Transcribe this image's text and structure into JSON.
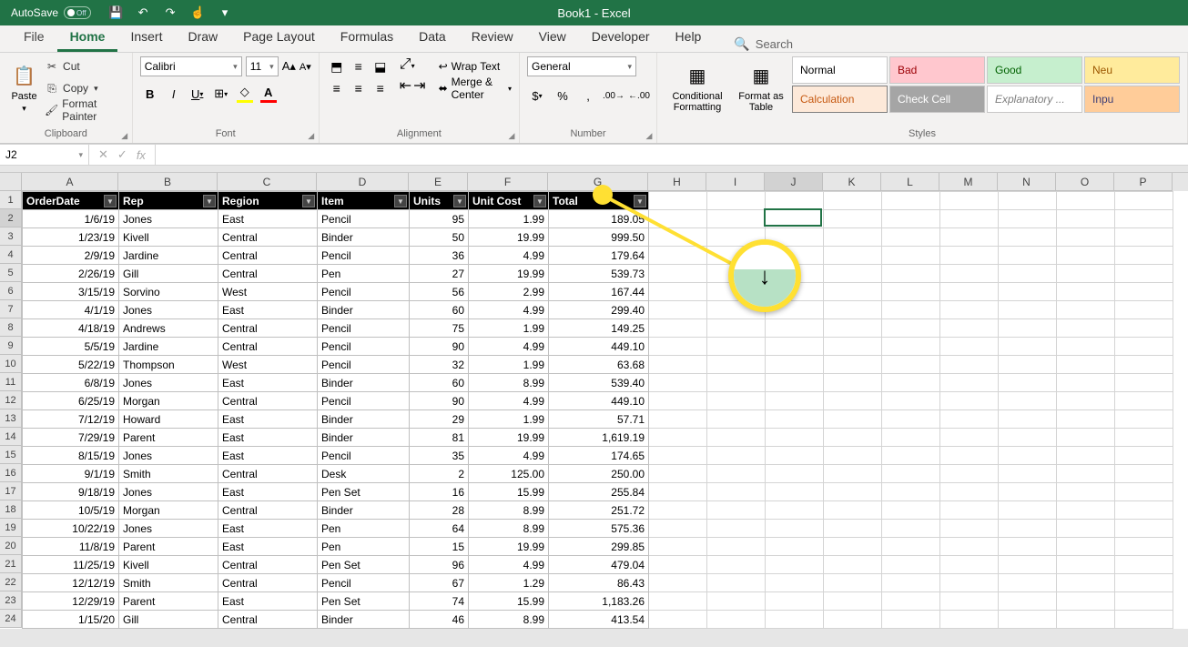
{
  "title": "Book1 - Excel",
  "autosave_label": "AutoSave",
  "autosave_state": "Off",
  "tabs": [
    "File",
    "Home",
    "Insert",
    "Draw",
    "Page Layout",
    "Formulas",
    "Data",
    "Review",
    "View",
    "Developer",
    "Help"
  ],
  "active_tab": "Home",
  "search_placeholder": "Search",
  "ribbon": {
    "clipboard": {
      "label": "Clipboard",
      "paste": "Paste",
      "cut": "Cut",
      "copy": "Copy",
      "painter": "Format Painter"
    },
    "font": {
      "label": "Font",
      "name": "Calibri",
      "size": "11"
    },
    "alignment": {
      "label": "Alignment",
      "wrap": "Wrap Text",
      "merge": "Merge & Center"
    },
    "number": {
      "label": "Number",
      "format": "General"
    },
    "styles": {
      "label": "Styles",
      "cond": "Conditional Formatting",
      "table": "Format as Table",
      "cells": [
        "Normal",
        "Bad",
        "Good",
        "Neu",
        "Calculation",
        "Check Cell",
        "Explanatory ...",
        "Inpu"
      ]
    }
  },
  "name_box": "J2",
  "formula": "",
  "columns": [
    "A",
    "B",
    "C",
    "D",
    "E",
    "F",
    "G",
    "H",
    "I",
    "J",
    "K",
    "L",
    "M",
    "N",
    "O",
    "P"
  ],
  "headers": [
    "OrderDate",
    "Rep",
    "Region",
    "Item",
    "Units",
    "Unit Cost",
    "Total"
  ],
  "rows": [
    [
      "1/6/19",
      "Jones",
      "East",
      "Pencil",
      "95",
      "1.99",
      "189.05"
    ],
    [
      "1/23/19",
      "Kivell",
      "Central",
      "Binder",
      "50",
      "19.99",
      "999.50"
    ],
    [
      "2/9/19",
      "Jardine",
      "Central",
      "Pencil",
      "36",
      "4.99",
      "179.64"
    ],
    [
      "2/26/19",
      "Gill",
      "Central",
      "Pen",
      "27",
      "19.99",
      "539.73"
    ],
    [
      "3/15/19",
      "Sorvino",
      "West",
      "Pencil",
      "56",
      "2.99",
      "167.44"
    ],
    [
      "4/1/19",
      "Jones",
      "East",
      "Binder",
      "60",
      "4.99",
      "299.40"
    ],
    [
      "4/18/19",
      "Andrews",
      "Central",
      "Pencil",
      "75",
      "1.99",
      "149.25"
    ],
    [
      "5/5/19",
      "Jardine",
      "Central",
      "Pencil",
      "90",
      "4.99",
      "449.10"
    ],
    [
      "5/22/19",
      "Thompson",
      "West",
      "Pencil",
      "32",
      "1.99",
      "63.68"
    ],
    [
      "6/8/19",
      "Jones",
      "East",
      "Binder",
      "60",
      "8.99",
      "539.40"
    ],
    [
      "6/25/19",
      "Morgan",
      "Central",
      "Pencil",
      "90",
      "4.99",
      "449.10"
    ],
    [
      "7/12/19",
      "Howard",
      "East",
      "Binder",
      "29",
      "1.99",
      "57.71"
    ],
    [
      "7/29/19",
      "Parent",
      "East",
      "Binder",
      "81",
      "19.99",
      "1,619.19"
    ],
    [
      "8/15/19",
      "Jones",
      "East",
      "Pencil",
      "35",
      "4.99",
      "174.65"
    ],
    [
      "9/1/19",
      "Smith",
      "Central",
      "Desk",
      "2",
      "125.00",
      "250.00"
    ],
    [
      "9/18/19",
      "Jones",
      "East",
      "Pen Set",
      "16",
      "15.99",
      "255.84"
    ],
    [
      "10/5/19",
      "Morgan",
      "Central",
      "Binder",
      "28",
      "8.99",
      "251.72"
    ],
    [
      "10/22/19",
      "Jones",
      "East",
      "Pen",
      "64",
      "8.99",
      "575.36"
    ],
    [
      "11/8/19",
      "Parent",
      "East",
      "Pen",
      "15",
      "19.99",
      "299.85"
    ],
    [
      "11/25/19",
      "Kivell",
      "Central",
      "Pen Set",
      "96",
      "4.99",
      "479.04"
    ],
    [
      "12/12/19",
      "Smith",
      "Central",
      "Pencil",
      "67",
      "1.29",
      "86.43"
    ],
    [
      "12/29/19",
      "Parent",
      "East",
      "Pen Set",
      "74",
      "15.99",
      "1,183.26"
    ],
    [
      "1/15/20",
      "Gill",
      "Central",
      "Binder",
      "46",
      "8.99",
      "413.54"
    ]
  ],
  "active_cell": {
    "col": "J",
    "row": 2
  }
}
